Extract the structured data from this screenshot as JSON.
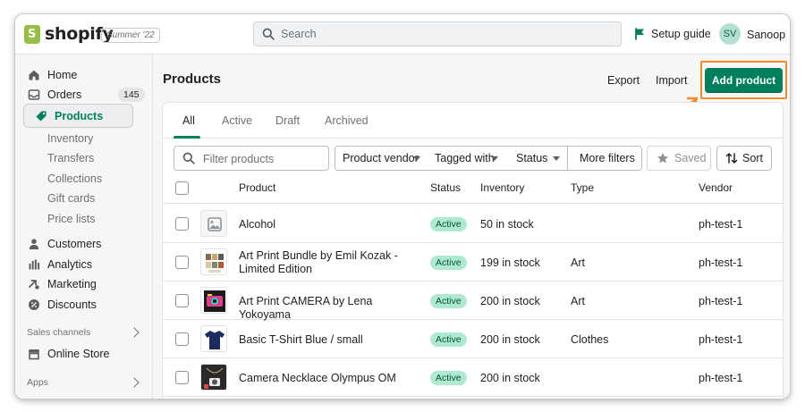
{
  "topbar": {
    "brand": "shopify",
    "edition_badge": "Summer '22",
    "search_placeholder": "Search",
    "setup_guide": "Setup guide",
    "avatar_initials": "SV",
    "username": "Sanoop"
  },
  "sidebar": {
    "home": "Home",
    "orders": "Orders",
    "orders_count": "145",
    "products": "Products",
    "inventory": "Inventory",
    "transfers": "Transfers",
    "collections": "Collections",
    "gift_cards": "Gift cards",
    "price_lists": "Price lists",
    "customers": "Customers",
    "analytics": "Analytics",
    "marketing": "Marketing",
    "discounts": "Discounts",
    "sales_channels": "Sales channels",
    "online_store": "Online Store",
    "apps": "Apps"
  },
  "header": {
    "title": "Products",
    "export": "Export",
    "import": "Import",
    "add_product": "Add product"
  },
  "tabs": [
    "All",
    "Active",
    "Draft",
    "Archived"
  ],
  "filters": {
    "search_placeholder": "Filter products",
    "vendor": "Product vendor",
    "tagged": "Tagged with",
    "status": "Status",
    "more": "More filters",
    "saved": "Saved",
    "sort": "Sort"
  },
  "columns": {
    "product": "Product",
    "status": "Status",
    "inventory": "Inventory",
    "type": "Type",
    "vendor": "Vendor"
  },
  "rows": [
    {
      "name": "Alcohol",
      "status": "Active",
      "inventory": "50 in stock",
      "type": "",
      "vendor": "ph-test-1"
    },
    {
      "name": "Art Print Bundle by Emil Kozak - Limited Edition",
      "status": "Active",
      "inventory": "199 in stock",
      "type": "Art",
      "vendor": "ph-test-1"
    },
    {
      "name": "Art Print CAMERA by Lena Yokoyama",
      "status": "Active",
      "inventory": "200 in stock",
      "type": "Art",
      "vendor": "ph-test-1"
    },
    {
      "name": "Basic T-Shirt Blue / small",
      "status": "Active",
      "inventory": "200 in stock",
      "type": "Clothes",
      "vendor": "ph-test-1"
    },
    {
      "name": "Camera Necklace Olympus OM",
      "status": "Active",
      "inventory": "200 in stock",
      "type": "",
      "vendor": "ph-test-1"
    }
  ],
  "colors": {
    "primary": "#007f5f",
    "highlight": "#f08a2c",
    "status_active_bg": "#aee9d1"
  }
}
